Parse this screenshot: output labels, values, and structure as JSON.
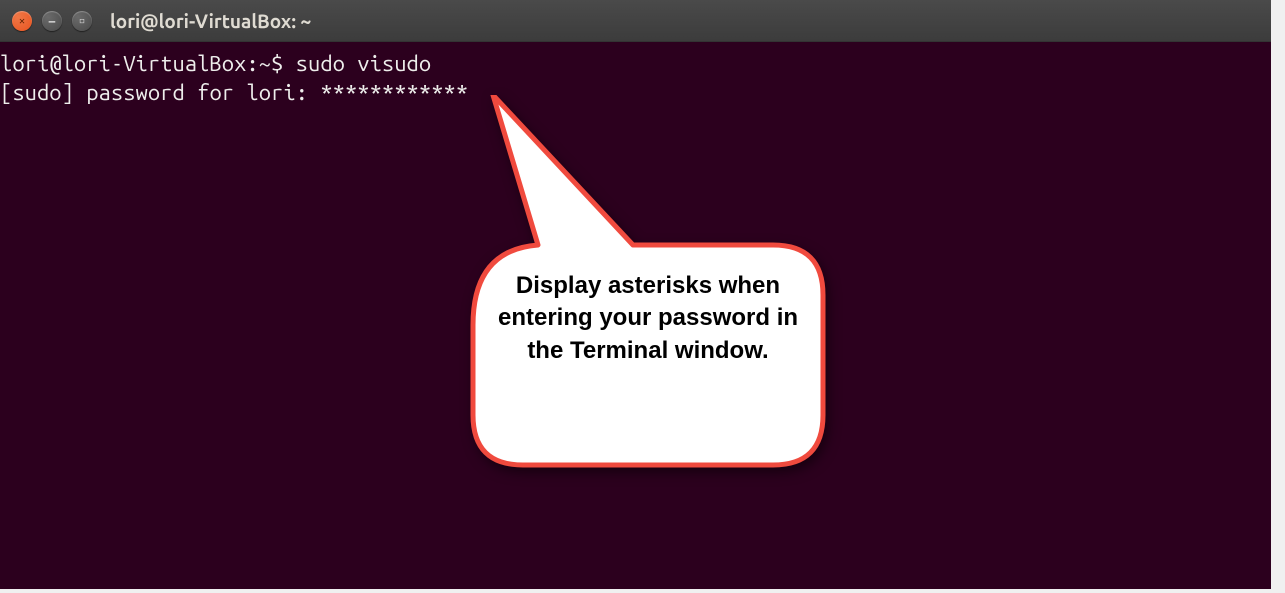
{
  "window": {
    "title": "lori@lori-VirtualBox: ~"
  },
  "terminal": {
    "line1": "lori@lori-VirtualBox:~$ sudo visudo",
    "line2": "[sudo] password for lori: ************"
  },
  "callout": {
    "text": "Display asterisks when entering your password in the Terminal window."
  },
  "colors": {
    "terminal_bg": "#2c001e",
    "terminal_fg": "#eeeeec",
    "accent": "#e95420",
    "callout_border": "#f04a3e"
  }
}
